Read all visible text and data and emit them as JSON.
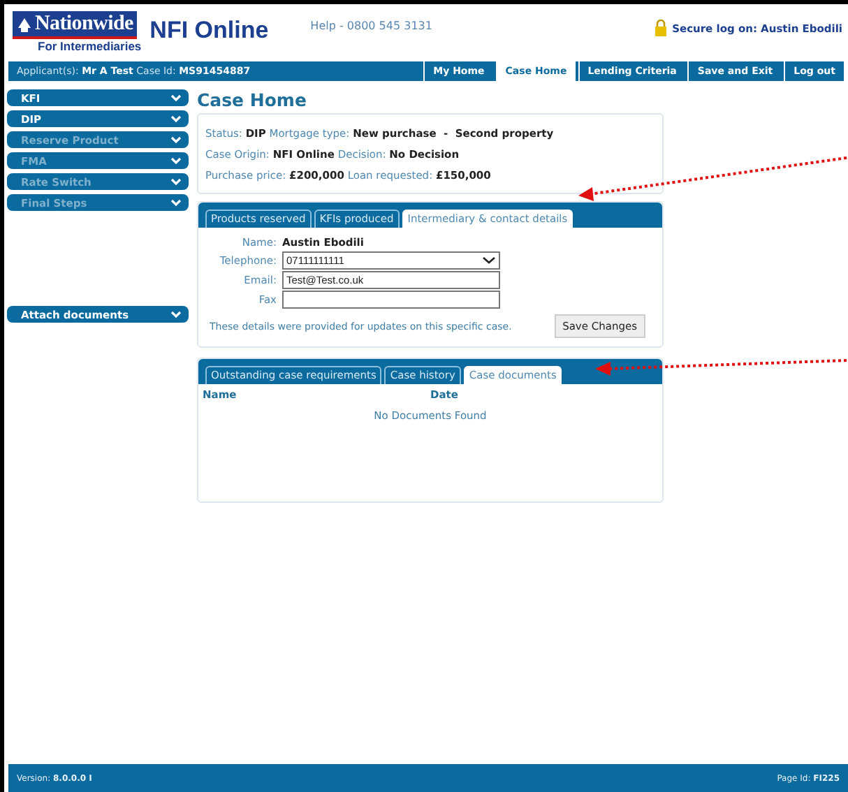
{
  "header": {
    "brand": "Nationwide",
    "brand_sub": "For Intermediaries",
    "product": "NFI Online",
    "help": "Help - 0800 545 3131",
    "login_label": "Secure log on:",
    "login_user": "Austin Ebodili"
  },
  "context_bar": [
    {
      "label": "Applicant(s):",
      "value": "Mr A Test"
    },
    {
      "label": "Case Id:",
      "value": "MS91454887"
    }
  ],
  "nav_tabs": [
    {
      "label": "My Home",
      "selected": false
    },
    {
      "label": "Case Home",
      "selected": true
    },
    {
      "label": "Lending Criteria",
      "selected": false
    },
    {
      "label": "Save and Exit",
      "selected": false
    },
    {
      "label": "Log out",
      "selected": false
    }
  ],
  "sidebar": {
    "items": [
      {
        "label": "KFI",
        "disabled": false
      },
      {
        "label": "DIP",
        "disabled": false
      },
      {
        "label": "Reserve Product",
        "disabled": true
      },
      {
        "label": "FMA",
        "disabled": true
      },
      {
        "label": "Rate Switch",
        "disabled": true
      },
      {
        "label": "Final Steps",
        "disabled": true
      }
    ],
    "attach": {
      "label": "Attach documents",
      "disabled": false
    }
  },
  "page_title": "Case Home",
  "summary": [
    [
      {
        "label": "Status:",
        "value": "DIP"
      },
      {
        "label": "Mortgage type:",
        "value": "New purchase  -  Second property"
      }
    ],
    [
      {
        "label": "Case Origin:",
        "value": "NFI Online"
      },
      {
        "label": "Decision:",
        "value": "No Decision"
      }
    ],
    [
      {
        "label": "Purchase price:",
        "value": "£200,000"
      },
      {
        "label": "Loan requested:",
        "value": "£150,000"
      }
    ]
  ],
  "contact_panel": {
    "tabs": [
      {
        "label": "Products reserved",
        "selected": false
      },
      {
        "label": "KFIs produced",
        "selected": false
      },
      {
        "label": "Intermediary & contact details",
        "selected": true
      }
    ],
    "fields": [
      {
        "label": "Name:",
        "kind": "text",
        "value": "Austin Ebodili"
      },
      {
        "label": "Telephone:",
        "kind": "select",
        "value": "07111111111"
      },
      {
        "label": "Email:",
        "kind": "input",
        "value": "Test@Test.co.uk"
      },
      {
        "label": "Fax",
        "kind": "input"
      }
    ],
    "note": "These details were provided for updates on this specific case.",
    "button": "Save Changes"
  },
  "documents_panel": {
    "tabs": [
      {
        "label": "Outstanding case requirements",
        "selected": false
      },
      {
        "label": "Case history",
        "selected": false
      },
      {
        "label": "Case documents",
        "selected": true
      }
    ],
    "columns": [
      "Name",
      "Date"
    ],
    "empty": "No Documents Found"
  },
  "footer": {
    "version_label": "Version:",
    "version": "8.0.0.0 I",
    "page_label": "Page Id:",
    "page_id": "FI225"
  }
}
